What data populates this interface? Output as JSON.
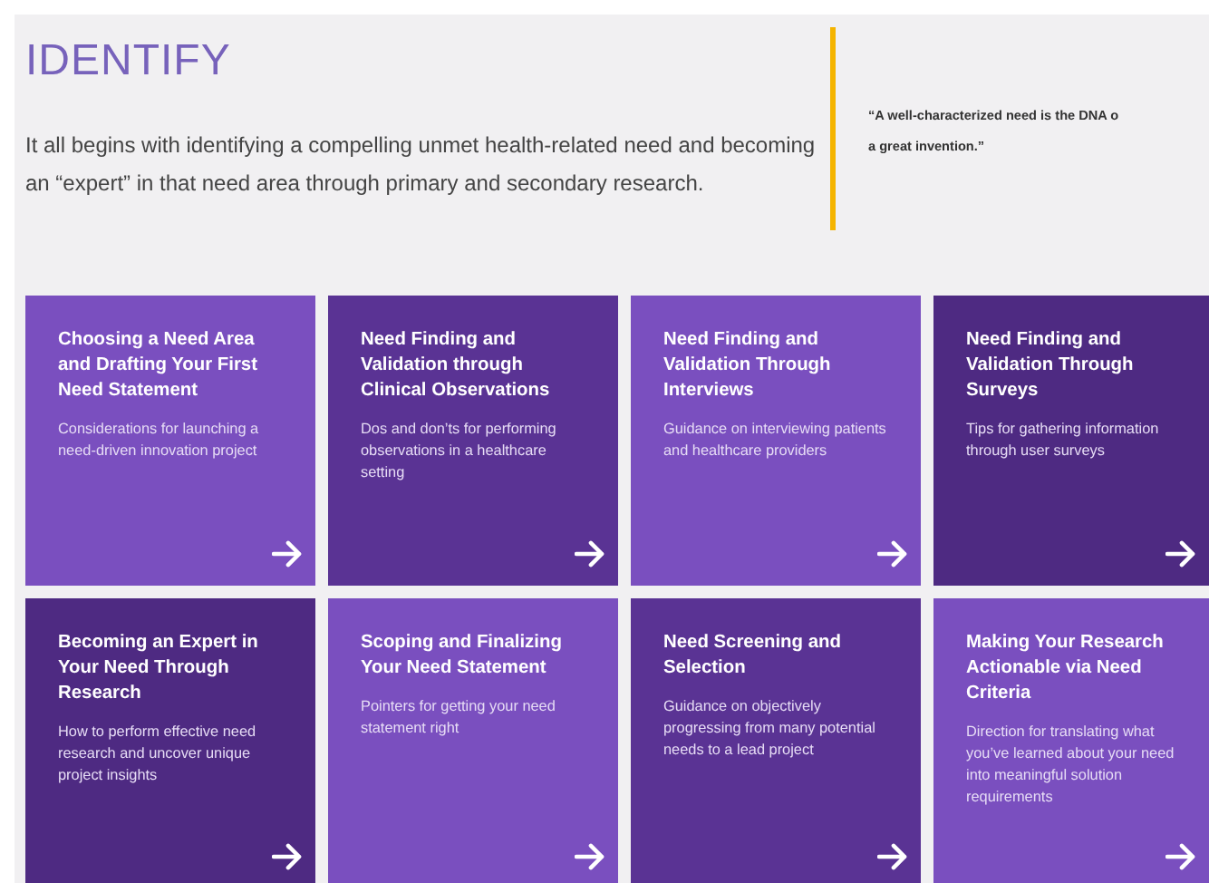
{
  "heading": "IDENTIFY",
  "intro": "It all begins with identifying a compelling unmet health-related need and becoming an “expert” in that need area through primary and secondary research.",
  "quote": [
    "“A well-characterized need is the DNA o",
    "a great invention.”"
  ],
  "cards": [
    {
      "title": "Choosing a Need Area and Drafting Your First Need Statement",
      "description": "Considerations for launching a need-driven innovation project",
      "color": "#7a4fbf"
    },
    {
      "title": "Need Finding and Validation through Clinical Observations",
      "description": "Dos and don’ts for performing observations in a healthcare setting",
      "color": "#5a3394"
    },
    {
      "title": "Need Finding and Validation Through Interviews",
      "description": "Guidance on interviewing patients and healthcare providers",
      "color": "#7a4fbf"
    },
    {
      "title": "Need Finding and Validation Through Surveys",
      "description": "Tips for gathering information through user surveys",
      "color": "#4e2a82"
    },
    {
      "title": "Becoming an Expert in Your Need Through Research",
      "description": "How to perform effective need research and uncover unique project insights",
      "color": "#4e2a82"
    },
    {
      "title": "Scoping and Finalizing Your Need Statement",
      "description": "Pointers for getting your need statement right",
      "color": "#7a4fbf"
    },
    {
      "title": "Need Screening and Selection",
      "description": "Guidance on objectively progressing from many potential needs to a lead project",
      "color": "#5a3394"
    },
    {
      "title": "Making Your Research Actionable via Need Criteria",
      "description": "Direction for translating what you’ve learned about your need into meaningful solution requirements",
      "color": "#7a4fbf"
    }
  ]
}
